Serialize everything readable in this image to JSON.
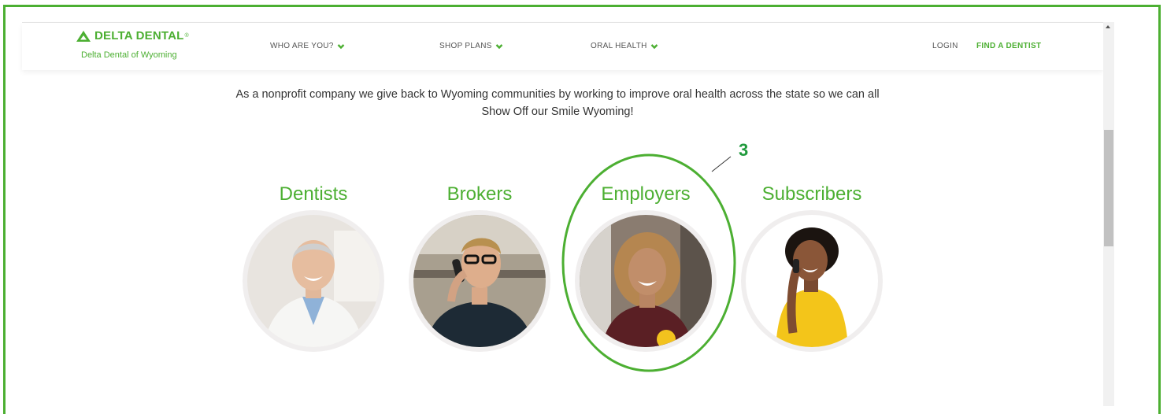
{
  "brand": {
    "name": "DELTA DENTAL",
    "registered_mark": "®",
    "subtitle": "Delta Dental of Wyoming",
    "logo_icon": "delta-triangle-icon",
    "accent_color": "#4caf32"
  },
  "nav": {
    "items": [
      {
        "label": "WHO ARE YOU?",
        "icon": "chevron-down-icon"
      },
      {
        "label": "SHOP PLANS",
        "icon": "chevron-down-icon"
      },
      {
        "label": "ORAL HEALTH",
        "icon": "chevron-down-icon"
      }
    ],
    "login": "LOGIN",
    "find_dentist": "FIND A DENTIST"
  },
  "intro": {
    "text": "As a nonprofit company we give back to Wyoming communities by working to improve oral health across the state so we can all Show Off our Smile Wyoming!"
  },
  "audiences": [
    {
      "label": "Dentists"
    },
    {
      "label": "Brokers"
    },
    {
      "label": "Employers"
    },
    {
      "label": "Subscribers"
    }
  ],
  "annotation": {
    "number": "3",
    "color": "#1f9a3c"
  }
}
